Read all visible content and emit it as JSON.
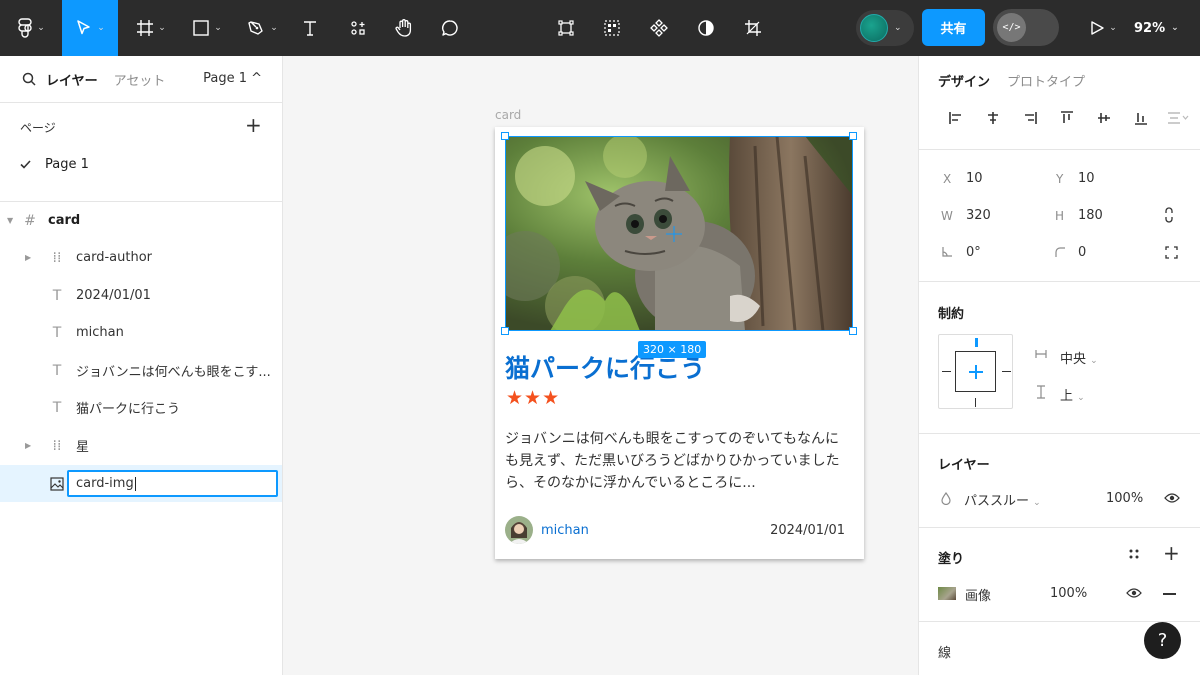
{
  "toolbar": {
    "share_label": "共有",
    "dev_mode_label": "</>",
    "zoom": "92%"
  },
  "left_panel": {
    "tab_layers": "レイヤー",
    "tab_assets": "アセット",
    "page_select": "Page 1 ^",
    "pages_title": "ページ",
    "pages_add": "+",
    "current_page": "Page 1",
    "layers": [
      {
        "name": "card"
      },
      {
        "name": "card-author"
      },
      {
        "name": "2024/01/01"
      },
      {
        "name": "michan"
      },
      {
        "name": "ジョバンニは何べんも眼をこす..."
      },
      {
        "name": "猫パークに行こう"
      },
      {
        "name": "星"
      },
      {
        "name": "card-img"
      }
    ]
  },
  "canvas": {
    "frame_label": "card",
    "size_badge": "320 × 180",
    "card": {
      "title": "猫パークに行こう",
      "stars": "★★★",
      "body": "ジョバンニは何べんも眼をこすってのぞいてもなんにも見えず、ただ黒いびろうどばかりひかっていましたら、そのなかに浮かんでいるところに...",
      "author": "michan",
      "date": "2024/01/01"
    }
  },
  "right_panel": {
    "tab_design": "デザイン",
    "tab_prototype": "プロトタイプ",
    "x_label": "X",
    "x_value": "10",
    "y_label": "Y",
    "y_value": "10",
    "w_label": "W",
    "w_value": "320",
    "h_label": "H",
    "h_value": "180",
    "rotation": "0°",
    "radius": "0",
    "constraints_title": "制約",
    "constraint_h": "中央",
    "constraint_v": "上",
    "layer_title": "レイヤー",
    "blend_mode": "パススルー",
    "layer_opacity": "100%",
    "fill_title": "塗り",
    "fill_type": "画像",
    "fill_opacity": "100%",
    "stroke_title": "線"
  },
  "help_label": "?",
  "colors": {
    "accent": "#0d99ff",
    "toolbar_bg": "#2c2c2c",
    "title_blue": "#0a6fd1",
    "star_orange": "#f4511e"
  }
}
